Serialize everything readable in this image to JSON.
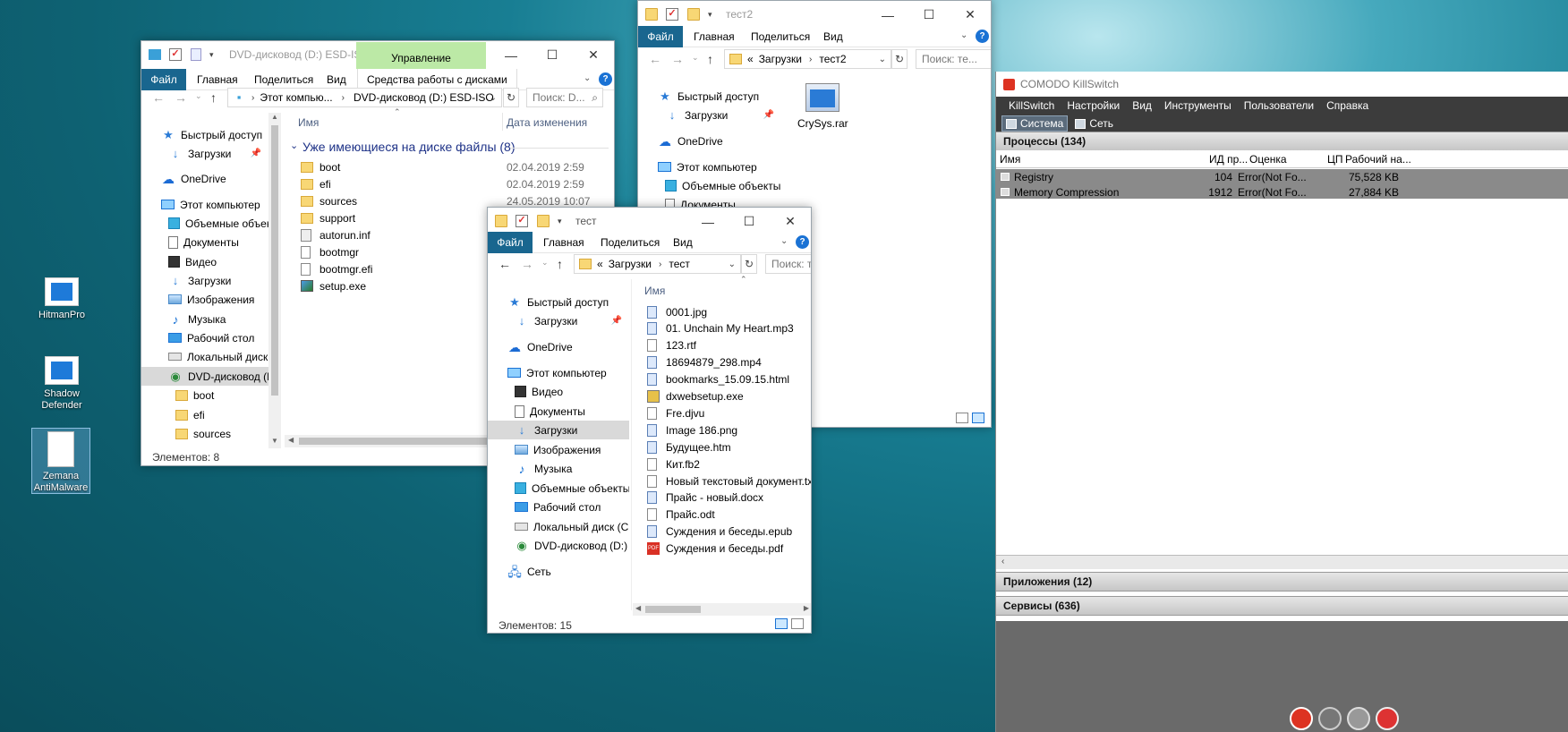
{
  "desktop": {
    "icons": [
      {
        "label": "HitmanPro"
      },
      {
        "label": "Shadow Defender"
      },
      {
        "label": "Zemana AntiMalware"
      }
    ]
  },
  "win_dvd": {
    "title": "DVD-дисковод (D:) ESD-ISO",
    "manage_tab": "Управление",
    "tabs": [
      "Файл",
      "Главная",
      "Поделиться",
      "Вид",
      "Средства работы с дисками"
    ],
    "address": [
      "Этот компью...",
      "DVD-дисковод (D:) ESD-ISO"
    ],
    "search_placeholder": "Поиск: D...",
    "nav": [
      "Быстрый доступ",
      "Загрузки",
      "OneDrive",
      "Этот компьютер",
      "Объемные объекты",
      "Документы",
      "Видео",
      "Загрузки",
      "Изображения",
      "Музыка",
      "Рабочий стол",
      "Локальный диск (C",
      "DVD-дисковод (D:)",
      "boot",
      "efi",
      "sources"
    ],
    "col_name": "Имя",
    "col_date": "Дата изменения",
    "group": "Уже имеющиеся на диске файлы (8)",
    "files": [
      {
        "name": "boot",
        "date": "02.04.2019 2:59"
      },
      {
        "name": "efi",
        "date": "02.04.2019 2:59"
      },
      {
        "name": "sources",
        "date": "24.05.2019 10:07"
      },
      {
        "name": "support",
        "date": ""
      },
      {
        "name": "autorun.inf",
        "date": ""
      },
      {
        "name": "bootmgr",
        "date": ""
      },
      {
        "name": "bootmgr.efi",
        "date": ""
      },
      {
        "name": "setup.exe",
        "date": ""
      }
    ],
    "status": "Элементов: 8"
  },
  "win_test2": {
    "title": "тест2",
    "tabs": [
      "Файл",
      "Главная",
      "Поделиться",
      "Вид"
    ],
    "address": [
      "«",
      "Загрузки",
      "тест2"
    ],
    "search_placeholder": "Поиск: те...",
    "nav": [
      "Быстрый доступ",
      "Загрузки",
      "OneDrive",
      "Этот компьютер",
      "Объемные объекты",
      "Документы"
    ],
    "file": "CrySys.rar"
  },
  "win_test": {
    "title": "тест",
    "tabs": [
      "Файл",
      "Главная",
      "Поделиться",
      "Вид"
    ],
    "address": [
      "«",
      "Загрузки",
      "тест"
    ],
    "search_placeholder": "Поиск: те",
    "nav": [
      "Быстрый доступ",
      "Загрузки",
      "OneDrive",
      "Этот компьютер",
      "Видео",
      "Документы",
      "Загрузки",
      "Изображения",
      "Музыка",
      "Объемные объекты",
      "Рабочий стол",
      "Локальный диск (C:)",
      "DVD-дисковод (D:) ESD",
      "Сеть"
    ],
    "col_name": "Имя",
    "files": [
      "0001.jpg",
      "01. Unchain My Heart.mp3",
      "123.rtf",
      "18694879_298.mp4",
      "bookmarks_15.09.15.html",
      "dxwebsetup.exe",
      "Fre.djvu",
      "Image 186.png",
      "Будущее.htm",
      "Кит.fb2",
      "Новый текстовый документ.txt",
      "Прайс - новый.docx",
      "Прайс.odt",
      "Суждения и беседы.epub",
      "Суждения и беседы.pdf"
    ],
    "status": "Элементов: 15"
  },
  "comodo": {
    "title": "COMODO KillSwitch",
    "menu": [
      "KillSwitch",
      "Настройки",
      "Вид",
      "Инструменты",
      "Пользователи",
      "Справка"
    ],
    "toolbar": [
      "Система",
      "Сеть"
    ],
    "processes_header": "Процессы (134)",
    "columns": [
      "Имя",
      "ИД пр...",
      "Оценка",
      "ЦП",
      "Рабочий на..."
    ],
    "rows": [
      {
        "name": "Registry",
        "pid": "104",
        "rating": "Error(Not Fo...",
        "mem": "75,528 KB"
      },
      {
        "name": "Memory Compression",
        "pid": "1912",
        "rating": "Error(Not Fo...",
        "mem": "27,884 KB"
      }
    ],
    "apps_header": "Приложения (12)",
    "services_header": "Сервисы (636)"
  }
}
